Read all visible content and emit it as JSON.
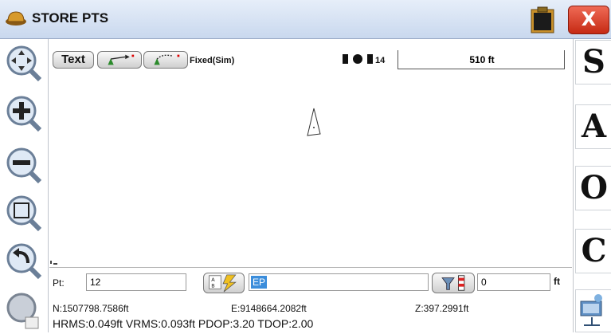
{
  "titlebar": {
    "title": "STORE PTS",
    "close_label": "X"
  },
  "toolbar": {
    "text_button": "Text",
    "fix_status": "Fixed(Sim)",
    "satellites": "14",
    "scale": "510 ft"
  },
  "right_buttons": [
    "S",
    "A",
    "O",
    "C"
  ],
  "point_row": {
    "pt_label": "Pt:",
    "pt_value": "12",
    "desc_value": "EP",
    "height_value": "0",
    "unit": "ft"
  },
  "coords": {
    "northing": "N:1507798.7586ft",
    "easting": "E:9148664.2082ft",
    "elevation": "Z:397.2991ft"
  },
  "precision": "HRMS:0.049ft VRMS:0.093ft PDOP:3.20 TDOP:2.00",
  "colors": {
    "titlebar": "#c9d8ee",
    "close_button": "#d63a22",
    "selected_text": "#3b8ddb"
  }
}
